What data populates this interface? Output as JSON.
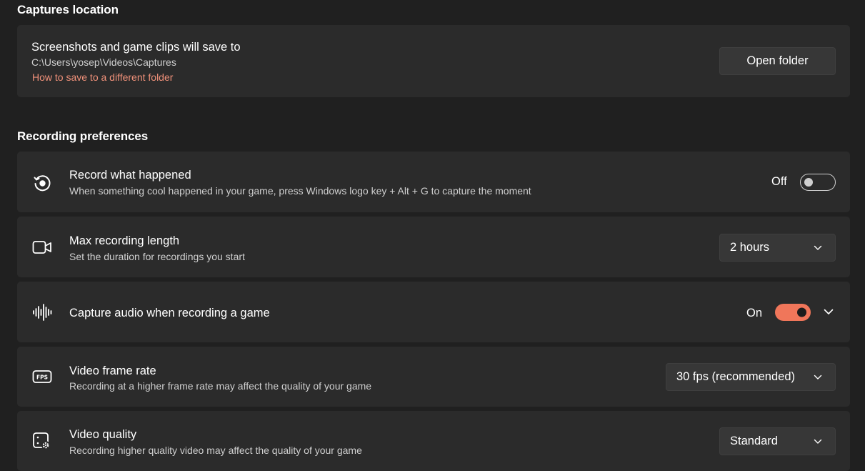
{
  "captures_location": {
    "heading": "Captures location",
    "title": "Screenshots and game clips will save to",
    "path": "C:\\Users\\yosep\\Videos\\Captures",
    "link": "How to save to a different folder",
    "button_label": "Open folder"
  },
  "recording_preferences": {
    "heading": "Recording preferences",
    "record_what_happened": {
      "icon": "record-history-icon",
      "title": "Record what happened",
      "description": "When something cool happened in your game, press Windows logo key + Alt + G to capture the moment",
      "state_text": "Off",
      "state": false
    },
    "max_recording_length": {
      "icon": "video-camera-icon",
      "title": "Max recording length",
      "description": "Set the duration for recordings you start",
      "selected": "2 hours"
    },
    "capture_audio": {
      "icon": "audio-waveform-icon",
      "title": "Capture audio when recording a game",
      "state_text": "On",
      "state": true
    },
    "video_frame_rate": {
      "icon": "fps-icon",
      "title": "Video frame rate",
      "description": "Recording at a higher frame rate may affect the quality of your game",
      "selected": "30 fps (recommended)"
    },
    "video_quality": {
      "icon": "video-quality-icon",
      "title": "Video quality",
      "description": "Recording higher quality video may affect the quality of your game",
      "selected": "Standard"
    }
  },
  "colors": {
    "background": "#202020",
    "card": "#2b2b2b",
    "accent": "#f0765a",
    "link": "#f0917a"
  }
}
